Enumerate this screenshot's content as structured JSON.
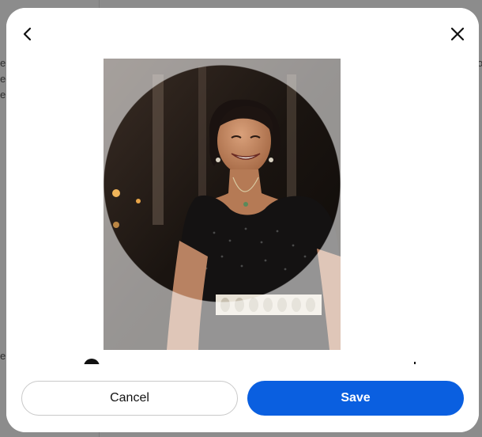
{
  "modal": {
    "title": "",
    "back_icon": "chevron-left-icon",
    "close_icon": "close-icon"
  },
  "background_fragments": {
    "left": [
      "er",
      "ec",
      "e",
      "er"
    ],
    "right": "o"
  },
  "zoom": {
    "value": 0.0
  },
  "photo": {
    "alt": "Profile photo of a smiling woman in a black sequined dress"
  },
  "buttons": {
    "cancel_label": "Cancel",
    "save_label": "Save"
  },
  "colors": {
    "primary": "#0a5fe0",
    "backdrop": "#8c8c8c"
  }
}
